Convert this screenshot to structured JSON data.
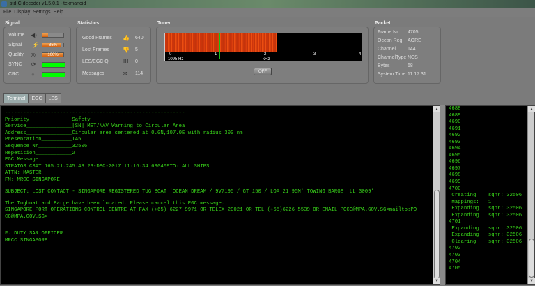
{
  "window": {
    "title": "std-C decoder v1.5.0.1 - tekmanoid"
  },
  "menu": [
    "File",
    "Display",
    "Settings",
    "Help"
  ],
  "signal": {
    "title": "Signal",
    "volume_label": "Volume",
    "volume": 0.25,
    "signal_label": "Signal",
    "signal_value": "85%",
    "signal": 0.85,
    "quality_label": "Quality",
    "quality_value": "100%",
    "quality": 1.0,
    "sync_label": "SYNC",
    "crc_label": "CRC"
  },
  "statistics": {
    "title": "Statistics",
    "items": [
      {
        "label": "Good Frames",
        "value": "640",
        "icon": "thumbs-up-icon"
      },
      {
        "label": "Lost Frames",
        "value": "5",
        "icon": "thumbs-down-icon"
      },
      {
        "label": "LES/EGC Q",
        "value": "0",
        "icon": "queue-icon"
      },
      {
        "label": "Messages",
        "value": "114",
        "icon": "envelope-icon"
      }
    ]
  },
  "tuner": {
    "title": "Tuner",
    "ticks": [
      "0",
      "1",
      "2",
      "3",
      "4"
    ],
    "freq": "1095 Hz",
    "unit": "kHz",
    "off_label": "OFF"
  },
  "packet": {
    "title": "Packet",
    "rows": [
      {
        "label": "Frame Nr",
        "value": "4705"
      },
      {
        "label": "Ocean Reg",
        "value": "AORE"
      },
      {
        "label": "Channel",
        "value": "144"
      },
      {
        "label": "ChannelType",
        "value": "NCS"
      },
      {
        "label": "Bytes",
        "value": "68"
      },
      {
        "label": "System Time",
        "value": "11:17:31:"
      }
    ]
  },
  "tabs": [
    "Terminal",
    "EGC",
    "LES"
  ],
  "terminal": {
    "lines": [
      "-----------------------------------------------------------",
      "Priority______________Safety",
      "Service_______________[SN] MET/NAV Warning to Circular Area",
      "Address_______________Circular area centered at 0.0N,107.0E with radius 300 nm",
      "Presentation__________IA5",
      "Sequence Nr___________32506",
      "Repetition____________2",
      "EGC Message:",
      "STRATOS CSAT 165.21.245.43 23-DEC-2017 11:16:34 690409TO: ALL SHIPS",
      "ATTN: MASTER",
      "FM: MRCC SINGAPORE",
      "",
      "SUBJECT: LOST CONTACT - SINGAPORE REGISTERED TUG BOAT 'OCEAN DREAM / 9V7195 / GT 150 / LOA 21.95M' TOWING BARGE 'LL 3009'",
      "",
      "The Tugboat and Barge have been located. Please cancel this EGC message.",
      "SINGAPORE PORT OPERATIONS CONTROL CENTRE AT FAX (+65) 6227 9971 OR TELEX 20021 OR TEL (+65)6226 5539 OR EMAIL POCC@MPA.GOV.SG<mailto:PO",
      "CC@MPA.GOV.SG>",
      "",
      "",
      "F. DUTY SAR OFFICER",
      "MRCC SINGAPORE"
    ]
  },
  "log": {
    "lines": [
      "4688",
      "4689",
      "4690",
      "4691",
      "4692",
      "4693",
      "4694",
      "4695",
      "4696",
      "4697",
      "4698",
      "4699",
      "4700",
      " Creating    sqnr: 32506",
      " Mappings:   1",
      " Expanding   sqnr: 32506",
      " Expanding   sqnr: 32506",
      "4701",
      " Expanding   sqnr: 32506",
      " Expanding   sqnr: 32506",
      " Clearing    sqnr: 32506",
      "4702",
      "4703",
      "4704",
      "4705"
    ]
  }
}
